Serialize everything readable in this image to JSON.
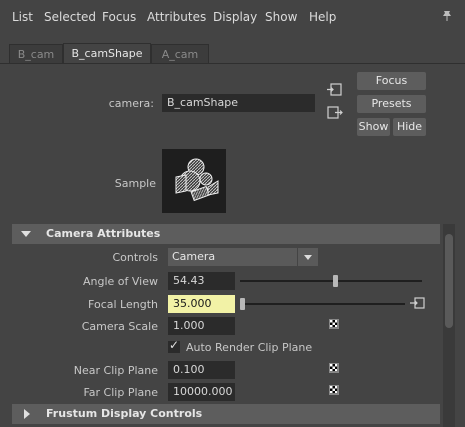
{
  "menu": [
    "List",
    "Selected",
    "Focus",
    "Attributes",
    "Display",
    "Show",
    "Help"
  ],
  "tabs": [
    "B_cam",
    "B_camShape",
    "A_cam"
  ],
  "active_tab": "B_camShape",
  "header": {
    "camera_label": "camera:",
    "camera_value": "B_camShape",
    "focus_button": "Focus",
    "presets_button": "Presets",
    "show_button": "Show",
    "hide_button": "Hide",
    "sample_label": "Sample"
  },
  "camera_attributes": {
    "title": "Camera Attributes",
    "controls_label": "Controls",
    "controls_value": "Camera",
    "angle_of_view_label": "Angle of View",
    "angle_of_view_value": "54.43",
    "angle_of_view_slider": 0.52,
    "focal_length_label": "Focal Length",
    "focal_length_value": "35.000",
    "focal_length_slider": 0.0,
    "camera_scale_label": "Camera Scale",
    "camera_scale_value": "1.000",
    "auto_render_clip_label": "Auto Render Clip Plane",
    "auto_render_clip_checked": true,
    "near_clip_label": "Near Clip Plane",
    "near_clip_value": "0.100",
    "far_clip_label": "Far Clip Plane",
    "far_clip_value": "10000.000"
  },
  "frustum": {
    "title": "Frustum Display Controls"
  },
  "colors": {
    "background": "#444444",
    "field": "#2b2b2b",
    "highlight_field": "#f2f2a6",
    "section_header": "#5d5d5d"
  }
}
